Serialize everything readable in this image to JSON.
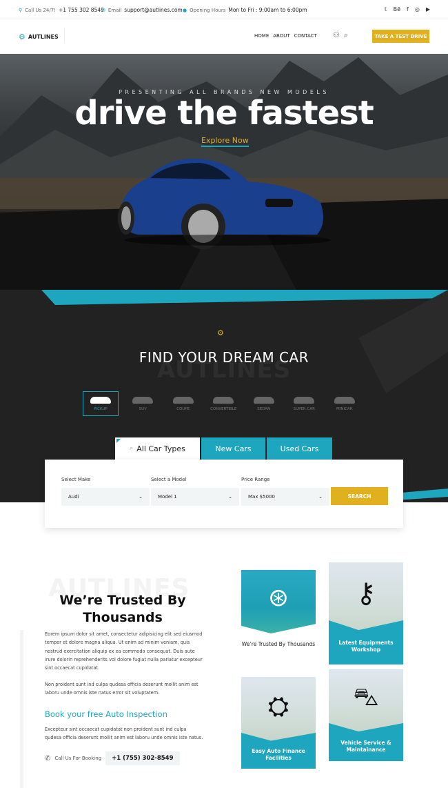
{
  "topbar": {
    "call_label": "Call Us 24/7!",
    "call_value": "+1 755 302 8549",
    "email_label": "Email",
    "email_value": "support@autlines.com",
    "hours_label": "Opening Hours",
    "hours_value": "Mon to Fri : 9:00am to 6:00pm",
    "social": [
      "twitter-icon",
      "behance-icon",
      "facebook-icon",
      "instagram-icon",
      "youtube-icon"
    ],
    "social_glyphs": [
      "🐦",
      "Bē",
      "f",
      "◎",
      "▶"
    ]
  },
  "header": {
    "logo": "AUTLINES",
    "nav": [
      "HOME",
      "ABOUT",
      "CONTACT"
    ],
    "cta": "TAKE A TEST DRIVE"
  },
  "hero": {
    "pretitle": "PRESENTING ALL BRANDS NEW MODELS",
    "title": "drive the fastest",
    "link": "Explore Now"
  },
  "finder": {
    "title": "FIND YOUR DREAM CAR",
    "watermark": "AUTLINES",
    "types": [
      "PICKUP",
      "SUV",
      "COUPE",
      "CONVERTIBLE",
      "SEDAN",
      "SUPER CAR",
      "MINICAR"
    ],
    "active_type": "PICKUP",
    "tabs": [
      "All Car Types",
      "New Cars",
      "Used Cars"
    ],
    "fields": [
      {
        "label": "Select Make",
        "value": "Audi"
      },
      {
        "label": "Select a Model",
        "value": "Model 1"
      },
      {
        "label": "Price Range",
        "value": "Max $5000"
      }
    ],
    "search": "SEARCH"
  },
  "about": {
    "watermark": "AUTLINES",
    "title": "We’re Trusted By Thousands",
    "p1": "Eorem ipsum dolor sit amet, consectetur adipisicing elit sed eiusmod tempor et dolore magna aliqua. Ut enim ad minim veniam, quis nostrud exercitation aliquip ex ea commodo consequat. Duis aute irure dolorin reprehenderits vol dolore fugiat nulla pariatur excepteur sint occaecat cupidatat.",
    "p2": "Non proident sunt ind culpa qudesa officia deserunt mollit anim est laboru unde omnis iste natus error sit voluptatem.",
    "book_title": "Book your free Auto Inspection",
    "p3": "Excepteur sint occaecat cupidatat non proident sunt ind culpa qudesa officia deserunt mollit anim est laboru unde omnis iste natus.",
    "call_label": "Call Us For Booking",
    "phone": "+1 (755) 302-8549"
  },
  "features": [
    {
      "title": "We’re Trusted By Thousands",
      "icon": "wheel-icon"
    },
    {
      "title": "Latest Equipments Workshop",
      "icon": "key-icon"
    },
    {
      "title": "Easy Auto Finance Facilities",
      "icon": "belt-icon"
    },
    {
      "title": "Vehicle Service & Maintainance",
      "icon": "car-check-icon"
    }
  ],
  "colors": {
    "accent": "#1fa6bf",
    "cta": "#e0b01e",
    "dark": "#222222"
  }
}
